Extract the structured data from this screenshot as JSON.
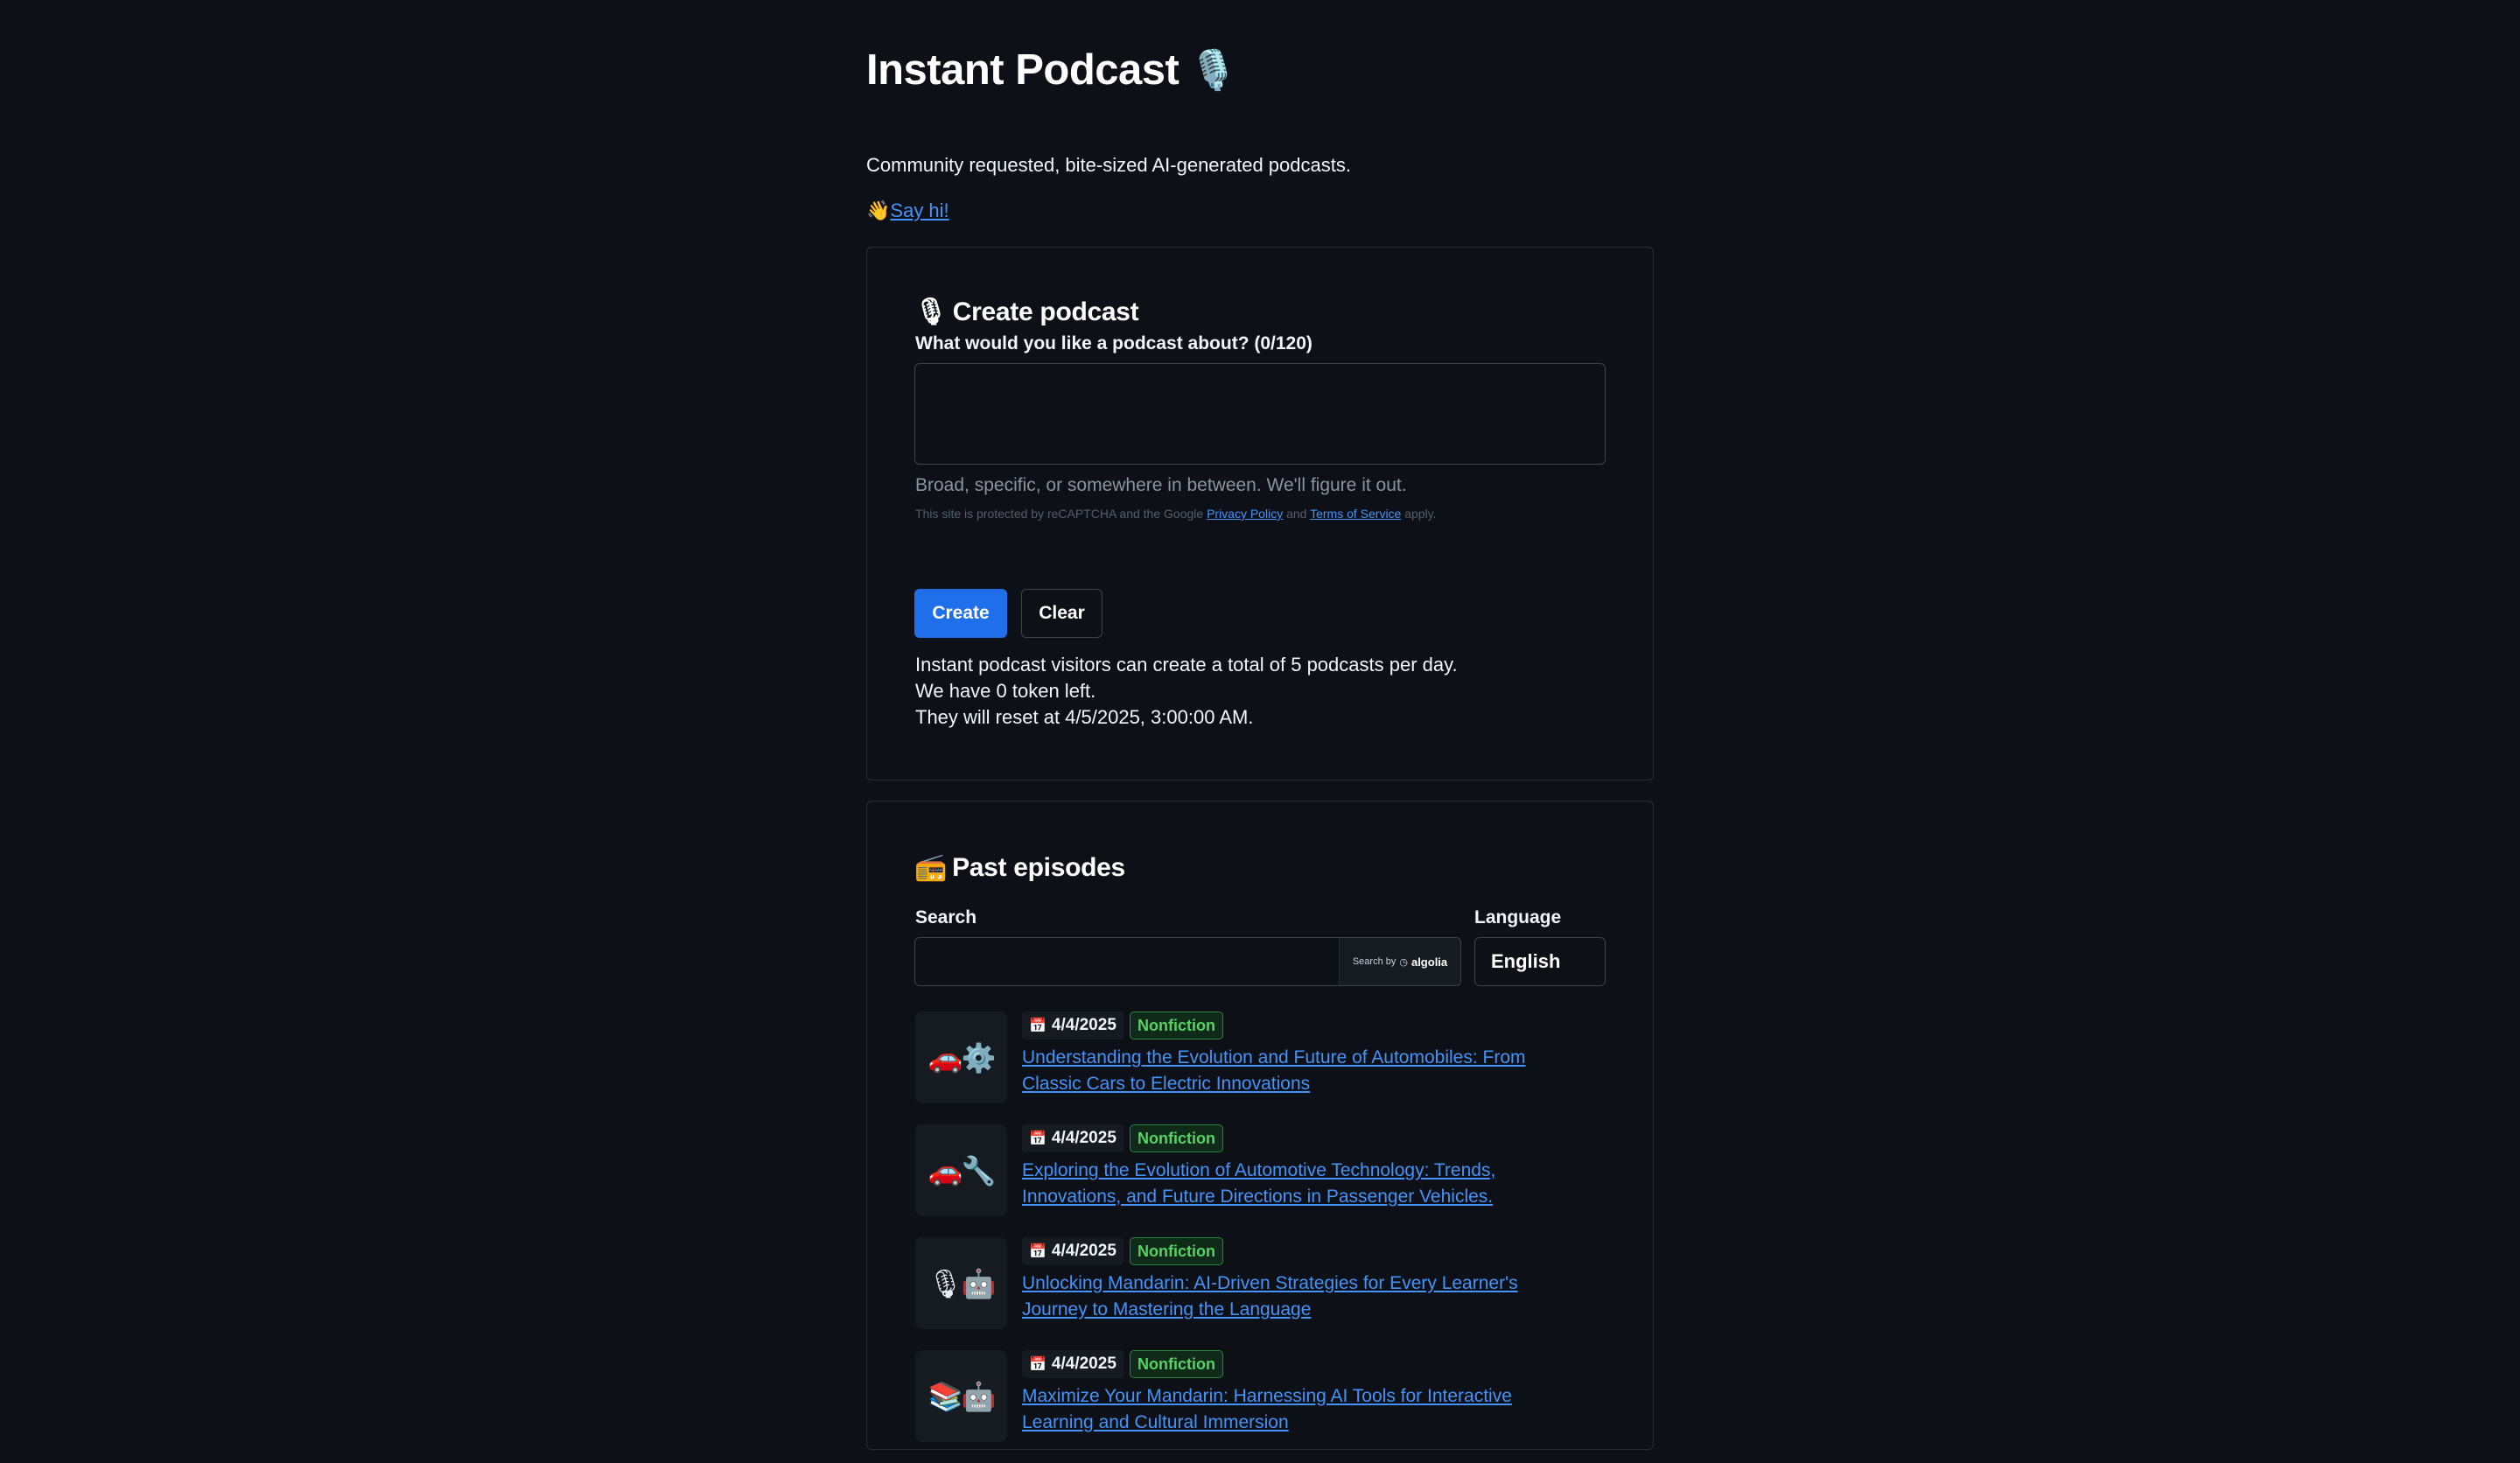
{
  "header": {
    "title": "Instant Podcast",
    "title_emoji": "🎙️",
    "subtitle": "Community requested, bite-sized AI-generated podcasts.",
    "sayhi_emoji": "👋",
    "sayhi_link": "Say hi!"
  },
  "create": {
    "heading_emoji": "🎙",
    "heading": "Create podcast",
    "topic_label": "What would you like a podcast about? (0/120)",
    "topic_value": "",
    "hint": "Broad, specific, or somewhere in between. We'll figure it out.",
    "recaptcha_prefix": "This site is protected by reCAPTCHA and the Google",
    "privacy_link": "Privacy Policy",
    "and_text": "and",
    "terms_link": "Terms of Service",
    "apply_text": "apply.",
    "create_button": "Create",
    "clear_button": "Clear",
    "quota_line1": "Instant podcast visitors can create a total of 5 podcasts per day.",
    "quota_line2": "We have 0 token left.",
    "quota_line3": "They will reset at 4/5/2025, 3:00:00 AM."
  },
  "past": {
    "heading_emoji": "📻",
    "heading": "Past episodes",
    "search_label": "Search",
    "search_value": "",
    "search_by": "Search by",
    "search_brand": "algolia",
    "language_label": "Language",
    "language_value": "English",
    "episodes": [
      {
        "thumb": "🚗⚙️",
        "date": "4/4/2025",
        "tag": "Nonfiction",
        "title": "Understanding the Evolution and Future of Automobiles: From Classic Cars to Electric Innovations"
      },
      {
        "thumb": "🚗🔧",
        "date": "4/4/2025",
        "tag": "Nonfiction",
        "title": "Exploring the Evolution of Automotive Technology: Trends, Innovations, and Future Directions in Passenger Vehicles."
      },
      {
        "thumb": "🎙🤖",
        "date": "4/4/2025",
        "tag": "Nonfiction",
        "title": "Unlocking Mandarin: AI-Driven Strategies for Every Learner's Journey to Mastering the Language"
      },
      {
        "thumb": "📚🤖",
        "date": "4/4/2025",
        "tag": "Nonfiction",
        "title": "Maximize Your Mandarin: Harnessing AI Tools for Interactive Learning and Cultural Immersion"
      }
    ]
  }
}
